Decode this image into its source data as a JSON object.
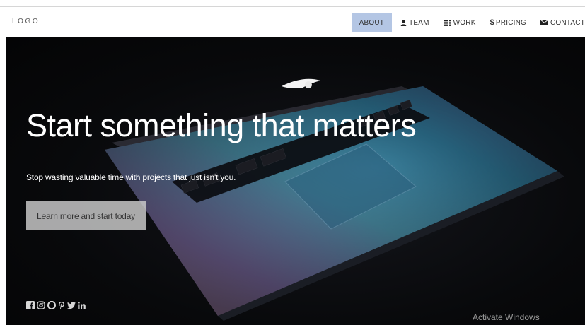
{
  "header": {
    "logo": "LOGO",
    "nav": [
      {
        "label": "ABOUT",
        "icon": "",
        "active": true
      },
      {
        "label": "TEAM",
        "icon": "user-icon",
        "active": false
      },
      {
        "label": "WORK",
        "icon": "grid-icon",
        "active": false
      },
      {
        "label": "PRICING",
        "icon": "dollar-icon",
        "active": false
      },
      {
        "label": "CONTACT",
        "icon": "envelope-icon",
        "active": false
      }
    ]
  },
  "hero": {
    "title": "Start something that matters",
    "subtitle": "Stop wasting valuable time with projects that just isn't you.",
    "cta_label": "Learn more and start today",
    "social_icons": [
      "facebook-icon",
      "instagram-icon",
      "opera-icon",
      "pinterest-icon",
      "twitter-icon",
      "linkedin-icon"
    ]
  },
  "overlay": {
    "watermark": "Activate Windows"
  },
  "colors": {
    "nav_active_bg": "#b4c6e4",
    "hero_bg": "#08090b",
    "cta_bg": "#cdcdcd"
  }
}
